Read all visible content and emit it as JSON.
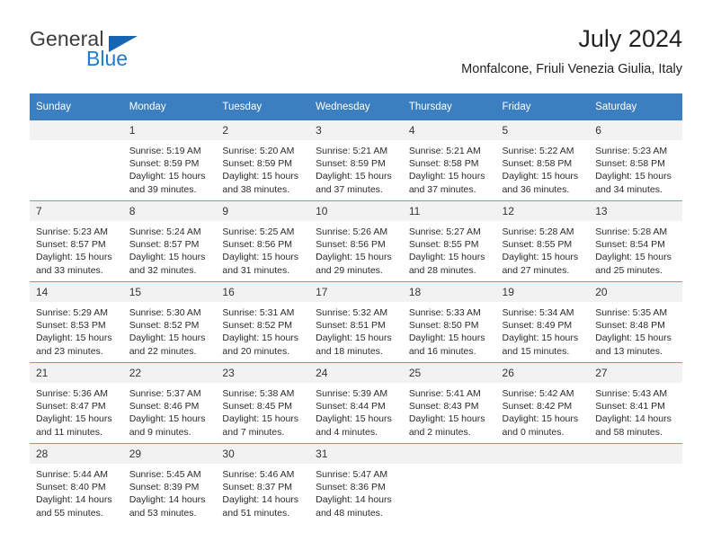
{
  "brand": {
    "word1": "General",
    "word2": "Blue",
    "triangle_color": "#1565b5",
    "blue_color": "#1f7ad1"
  },
  "header": {
    "title": "July 2024",
    "subtitle": "Monfalcone, Friuli Venezia Giulia, Italy"
  },
  "theme": {
    "header_bg": "#3c7fc1",
    "header_text": "#ffffff",
    "daynum_bg": "#f2f2f2",
    "row_divider": "#6a9fd4"
  },
  "weekday_headers": [
    "Sunday",
    "Monday",
    "Tuesday",
    "Wednesday",
    "Thursday",
    "Friday",
    "Saturday"
  ],
  "labels": {
    "sunrise_prefix": "Sunrise:",
    "sunset_prefix": "Sunset:",
    "daylight_prefix": "Daylight:"
  },
  "weeks": [
    [
      {
        "day": "",
        "empty": true,
        "line1": "",
        "line2": "",
        "line3": "",
        "line4": ""
      },
      {
        "day": "1",
        "line1": "Sunrise: 5:19 AM",
        "line2": "Sunset: 8:59 PM",
        "line3": "Daylight: 15 hours",
        "line4": "and 39 minutes."
      },
      {
        "day": "2",
        "line1": "Sunrise: 5:20 AM",
        "line2": "Sunset: 8:59 PM",
        "line3": "Daylight: 15 hours",
        "line4": "and 38 minutes."
      },
      {
        "day": "3",
        "line1": "Sunrise: 5:21 AM",
        "line2": "Sunset: 8:59 PM",
        "line3": "Daylight: 15 hours",
        "line4": "and 37 minutes."
      },
      {
        "day": "4",
        "line1": "Sunrise: 5:21 AM",
        "line2": "Sunset: 8:58 PM",
        "line3": "Daylight: 15 hours",
        "line4": "and 37 minutes."
      },
      {
        "day": "5",
        "line1": "Sunrise: 5:22 AM",
        "line2": "Sunset: 8:58 PM",
        "line3": "Daylight: 15 hours",
        "line4": "and 36 minutes."
      },
      {
        "day": "6",
        "line1": "Sunrise: 5:23 AM",
        "line2": "Sunset: 8:58 PM",
        "line3": "Daylight: 15 hours",
        "line4": "and 34 minutes."
      }
    ],
    [
      {
        "day": "7",
        "line1": "Sunrise: 5:23 AM",
        "line2": "Sunset: 8:57 PM",
        "line3": "Daylight: 15 hours",
        "line4": "and 33 minutes."
      },
      {
        "day": "8",
        "line1": "Sunrise: 5:24 AM",
        "line2": "Sunset: 8:57 PM",
        "line3": "Daylight: 15 hours",
        "line4": "and 32 minutes."
      },
      {
        "day": "9",
        "line1": "Sunrise: 5:25 AM",
        "line2": "Sunset: 8:56 PM",
        "line3": "Daylight: 15 hours",
        "line4": "and 31 minutes."
      },
      {
        "day": "10",
        "line1": "Sunrise: 5:26 AM",
        "line2": "Sunset: 8:56 PM",
        "line3": "Daylight: 15 hours",
        "line4": "and 29 minutes."
      },
      {
        "day": "11",
        "line1": "Sunrise: 5:27 AM",
        "line2": "Sunset: 8:55 PM",
        "line3": "Daylight: 15 hours",
        "line4": "and 28 minutes."
      },
      {
        "day": "12",
        "line1": "Sunrise: 5:28 AM",
        "line2": "Sunset: 8:55 PM",
        "line3": "Daylight: 15 hours",
        "line4": "and 27 minutes."
      },
      {
        "day": "13",
        "line1": "Sunrise: 5:28 AM",
        "line2": "Sunset: 8:54 PM",
        "line3": "Daylight: 15 hours",
        "line4": "and 25 minutes."
      }
    ],
    [
      {
        "day": "14",
        "line1": "Sunrise: 5:29 AM",
        "line2": "Sunset: 8:53 PM",
        "line3": "Daylight: 15 hours",
        "line4": "and 23 minutes."
      },
      {
        "day": "15",
        "line1": "Sunrise: 5:30 AM",
        "line2": "Sunset: 8:52 PM",
        "line3": "Daylight: 15 hours",
        "line4": "and 22 minutes."
      },
      {
        "day": "16",
        "line1": "Sunrise: 5:31 AM",
        "line2": "Sunset: 8:52 PM",
        "line3": "Daylight: 15 hours",
        "line4": "and 20 minutes."
      },
      {
        "day": "17",
        "line1": "Sunrise: 5:32 AM",
        "line2": "Sunset: 8:51 PM",
        "line3": "Daylight: 15 hours",
        "line4": "and 18 minutes."
      },
      {
        "day": "18",
        "line1": "Sunrise: 5:33 AM",
        "line2": "Sunset: 8:50 PM",
        "line3": "Daylight: 15 hours",
        "line4": "and 16 minutes."
      },
      {
        "day": "19",
        "line1": "Sunrise: 5:34 AM",
        "line2": "Sunset: 8:49 PM",
        "line3": "Daylight: 15 hours",
        "line4": "and 15 minutes."
      },
      {
        "day": "20",
        "line1": "Sunrise: 5:35 AM",
        "line2": "Sunset: 8:48 PM",
        "line3": "Daylight: 15 hours",
        "line4": "and 13 minutes."
      }
    ],
    [
      {
        "day": "21",
        "line1": "Sunrise: 5:36 AM",
        "line2": "Sunset: 8:47 PM",
        "line3": "Daylight: 15 hours",
        "line4": "and 11 minutes."
      },
      {
        "day": "22",
        "line1": "Sunrise: 5:37 AM",
        "line2": "Sunset: 8:46 PM",
        "line3": "Daylight: 15 hours",
        "line4": "and 9 minutes."
      },
      {
        "day": "23",
        "line1": "Sunrise: 5:38 AM",
        "line2": "Sunset: 8:45 PM",
        "line3": "Daylight: 15 hours",
        "line4": "and 7 minutes."
      },
      {
        "day": "24",
        "line1": "Sunrise: 5:39 AM",
        "line2": "Sunset: 8:44 PM",
        "line3": "Daylight: 15 hours",
        "line4": "and 4 minutes."
      },
      {
        "day": "25",
        "line1": "Sunrise: 5:41 AM",
        "line2": "Sunset: 8:43 PM",
        "line3": "Daylight: 15 hours",
        "line4": "and 2 minutes."
      },
      {
        "day": "26",
        "line1": "Sunrise: 5:42 AM",
        "line2": "Sunset: 8:42 PM",
        "line3": "Daylight: 15 hours",
        "line4": "and 0 minutes."
      },
      {
        "day": "27",
        "line1": "Sunrise: 5:43 AM",
        "line2": "Sunset: 8:41 PM",
        "line3": "Daylight: 14 hours",
        "line4": "and 58 minutes."
      }
    ],
    [
      {
        "day": "28",
        "line1": "Sunrise: 5:44 AM",
        "line2": "Sunset: 8:40 PM",
        "line3": "Daylight: 14 hours",
        "line4": "and 55 minutes."
      },
      {
        "day": "29",
        "line1": "Sunrise: 5:45 AM",
        "line2": "Sunset: 8:39 PM",
        "line3": "Daylight: 14 hours",
        "line4": "and 53 minutes."
      },
      {
        "day": "30",
        "line1": "Sunrise: 5:46 AM",
        "line2": "Sunset: 8:37 PM",
        "line3": "Daylight: 14 hours",
        "line4": "and 51 minutes."
      },
      {
        "day": "31",
        "line1": "Sunrise: 5:47 AM",
        "line2": "Sunset: 8:36 PM",
        "line3": "Daylight: 14 hours",
        "line4": "and 48 minutes."
      },
      {
        "day": "",
        "empty": true,
        "line1": "",
        "line2": "",
        "line3": "",
        "line4": ""
      },
      {
        "day": "",
        "empty": true,
        "line1": "",
        "line2": "",
        "line3": "",
        "line4": ""
      },
      {
        "day": "",
        "empty": true,
        "line1": "",
        "line2": "",
        "line3": "",
        "line4": ""
      }
    ]
  ]
}
